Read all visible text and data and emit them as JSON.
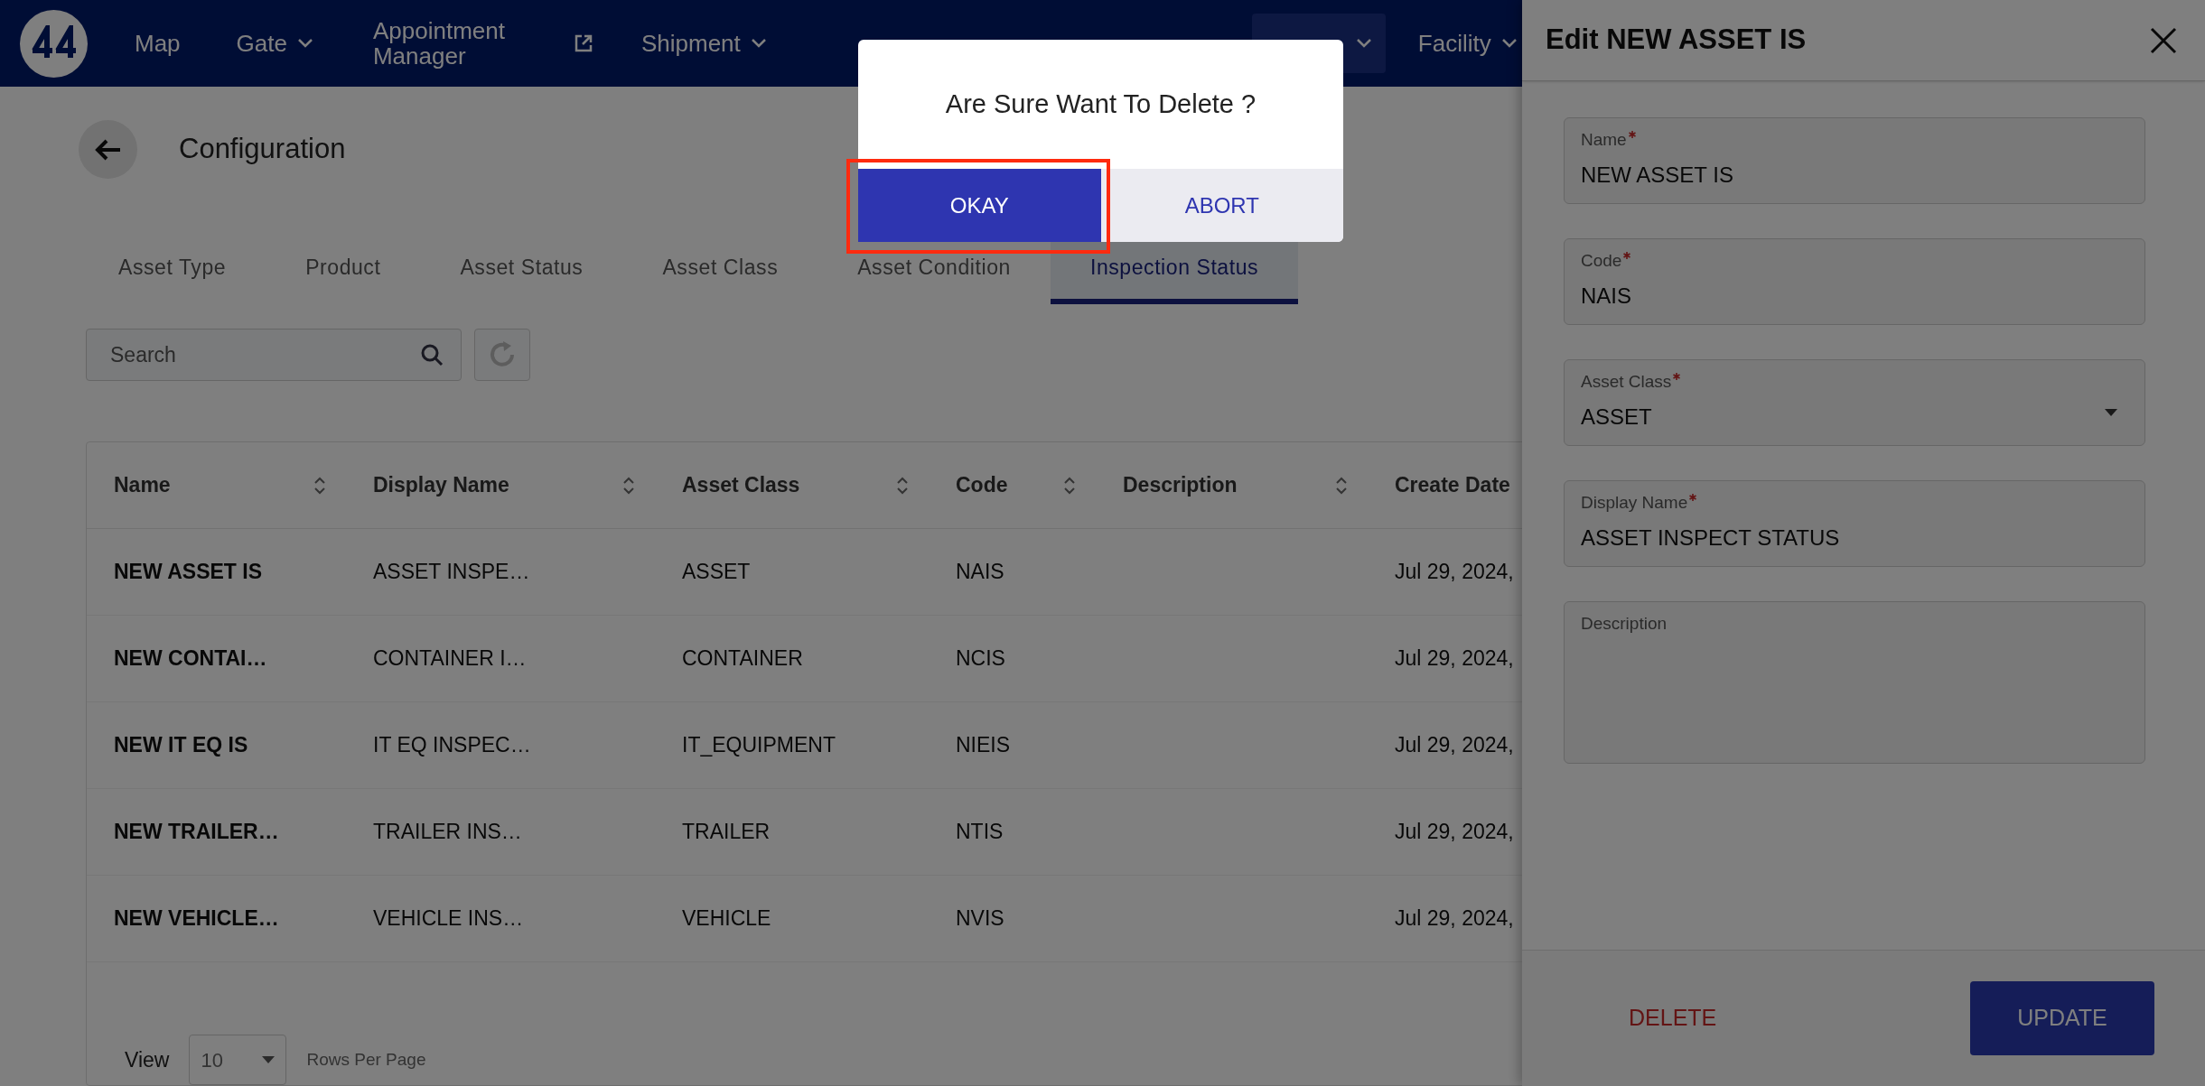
{
  "nav": {
    "items": [
      {
        "label": "Map",
        "kind": "link",
        "selected": false
      },
      {
        "label": "Gate",
        "kind": "menu",
        "selected": false
      },
      {
        "label": "Appointment Manager",
        "kind": "external",
        "selected": false
      },
      {
        "label": "Shipment",
        "kind": "menu",
        "selected": false
      },
      {
        "kind": "menu",
        "selected": true
      },
      {
        "label": "Facility",
        "kind": "menu",
        "selected": false
      }
    ]
  },
  "page": {
    "title": "Configuration"
  },
  "tabs": [
    {
      "label": "Asset Type",
      "selected": false
    },
    {
      "label": "Product",
      "selected": false
    },
    {
      "label": "Asset Status",
      "selected": false
    },
    {
      "label": "Asset Class",
      "selected": false
    },
    {
      "label": "Asset Condition",
      "selected": false
    },
    {
      "label": "Inspection Status",
      "selected": true
    }
  ],
  "search": {
    "placeholder": "Search"
  },
  "table": {
    "columns": [
      {
        "label": "Name",
        "sortable": true
      },
      {
        "label": "Display Name",
        "sortable": true
      },
      {
        "label": "Asset Class",
        "sortable": true
      },
      {
        "label": "Code",
        "sortable": true
      },
      {
        "label": "Description",
        "sortable": true
      },
      {
        "label": "Create Date",
        "sortable": false
      }
    ],
    "rows": [
      [
        "NEW ASSET IS",
        "ASSET INSPE…",
        "ASSET",
        "NAIS",
        "",
        "Jul 29, 2024,"
      ],
      [
        "NEW CONTAI…",
        "CONTAINER I…",
        "CONTAINER",
        "NCIS",
        "",
        "Jul 29, 2024,"
      ],
      [
        "NEW IT EQ IS",
        "IT EQ INSPEC…",
        "IT_EQUIPMENT",
        "NIEIS",
        "",
        "Jul 29, 2024,"
      ],
      [
        "NEW TRAILER…",
        "TRAILER INS…",
        "TRAILER",
        "NTIS",
        "",
        "Jul 29, 2024,"
      ],
      [
        "NEW VEHICLE…",
        "VEHICLE INS…",
        "VEHICLE",
        "NVIS",
        "",
        "Jul 29, 2024,"
      ]
    ]
  },
  "pagination": {
    "label": "View",
    "rows_per_page": "10",
    "suffix": "Rows Per Page"
  },
  "edit_panel": {
    "title": "Edit NEW ASSET IS",
    "fields": [
      {
        "label": "Name",
        "required": true,
        "value": "NEW ASSET IS",
        "kind": "text"
      },
      {
        "label": "Code",
        "required": true,
        "value": "NAIS",
        "kind": "text"
      },
      {
        "label": "Asset Class",
        "required": true,
        "value": "ASSET",
        "kind": "select"
      },
      {
        "label": "Display Name",
        "required": true,
        "value": "ASSET INSPECT STATUS",
        "kind": "text"
      },
      {
        "label": "Description",
        "required": false,
        "kind": "textarea"
      }
    ],
    "buttons": [
      {
        "label": "DELETE",
        "kind": "text"
      },
      {
        "label": "UPDATE",
        "kind": "primary"
      }
    ]
  },
  "dialog": {
    "message": "Are Sure Want To Delete ?",
    "buttons": [
      {
        "label": "OKAY",
        "kind": "primary",
        "highlighted": true
      },
      {
        "label": "ABORT",
        "kind": "secondary",
        "highlighted": false
      }
    ]
  }
}
